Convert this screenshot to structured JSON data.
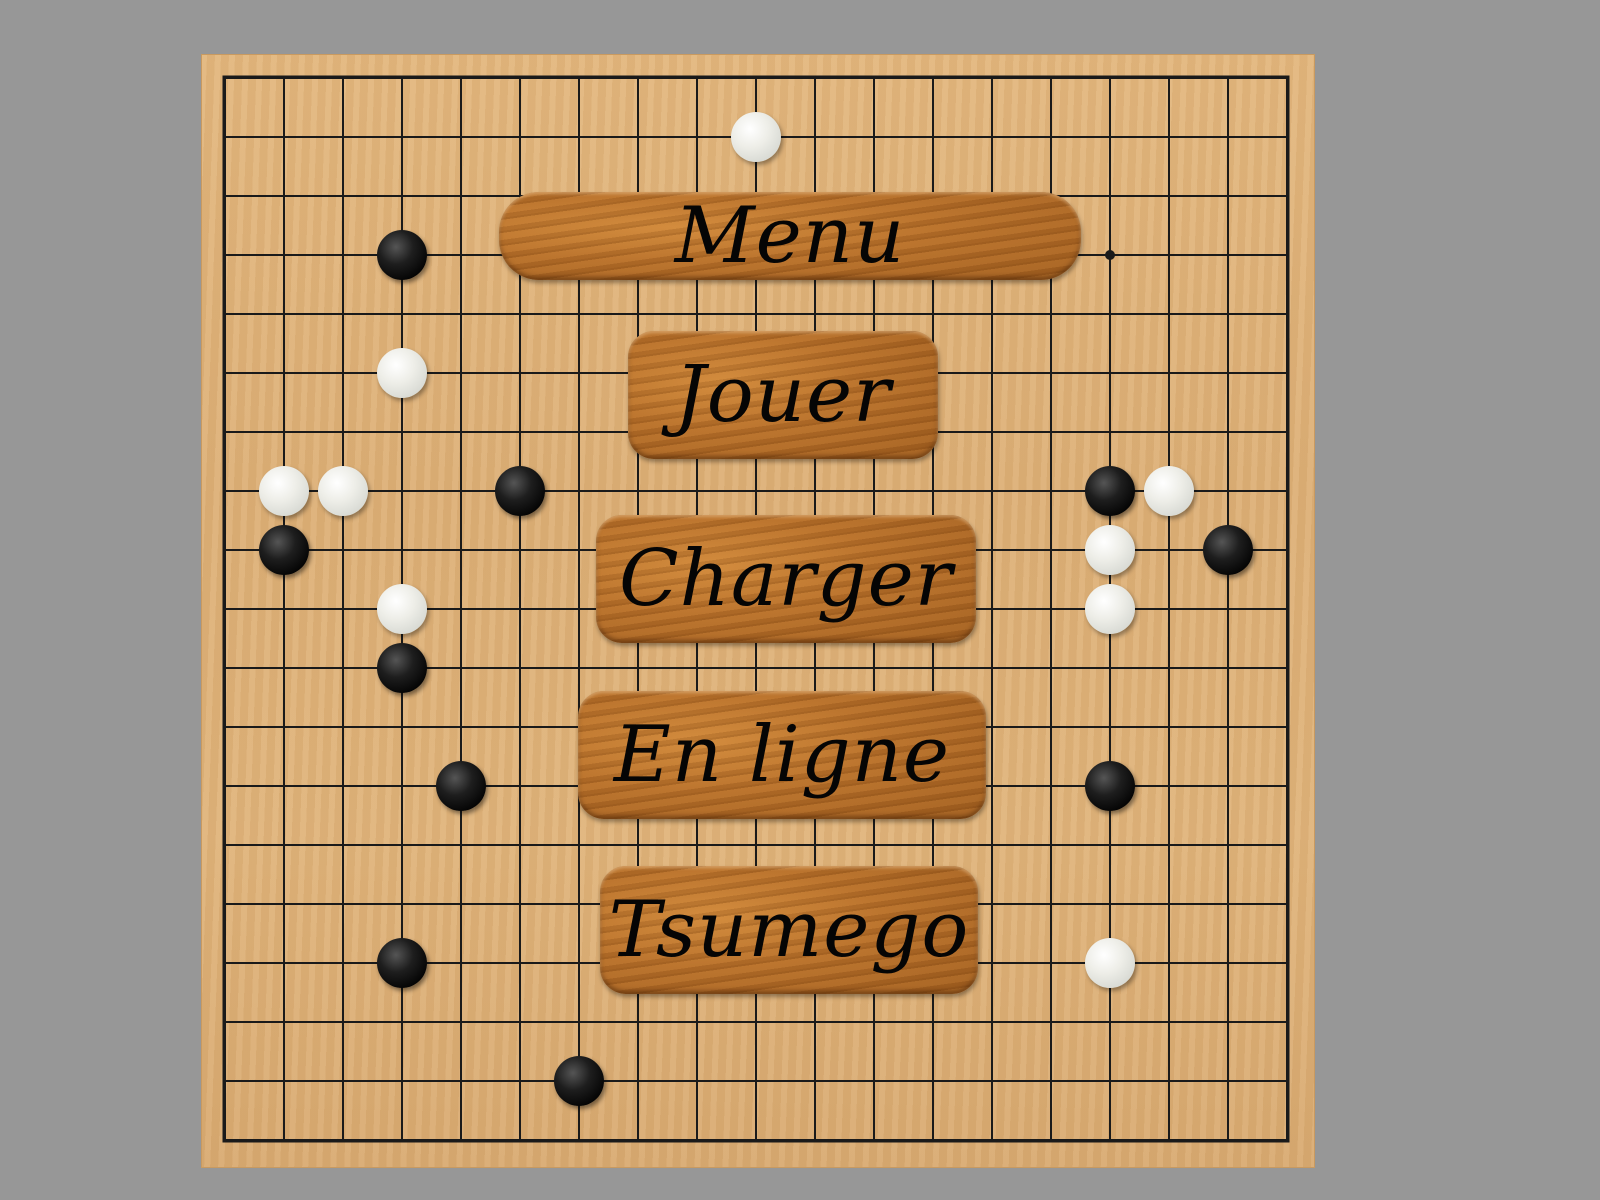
{
  "menu": {
    "title": "Menu",
    "items": [
      {
        "label": "Jouer"
      },
      {
        "label": "Charger"
      },
      {
        "label": "En ligne"
      },
      {
        "label": "Tsumego"
      }
    ]
  },
  "board": {
    "size": 19,
    "colors": {
      "black": "#0a0a0a",
      "white": "#e8e9e4",
      "wood": "#dfb37a",
      "plank": "#b8702a",
      "line": "#1a1a1a"
    },
    "star_points": [
      {
        "col": 15,
        "row": 3
      }
    ],
    "stones": [
      {
        "color": "white",
        "col": 9,
        "row": 1
      },
      {
        "color": "black",
        "col": 3,
        "row": 3
      },
      {
        "color": "white",
        "col": 3,
        "row": 5
      },
      {
        "color": "white",
        "col": 1,
        "row": 7
      },
      {
        "color": "white",
        "col": 2,
        "row": 7
      },
      {
        "color": "black",
        "col": 5,
        "row": 7
      },
      {
        "color": "black",
        "col": 15,
        "row": 7
      },
      {
        "color": "white",
        "col": 16,
        "row": 7
      },
      {
        "color": "black",
        "col": 1,
        "row": 8
      },
      {
        "color": "white",
        "col": 15,
        "row": 8
      },
      {
        "color": "black",
        "col": 17,
        "row": 8
      },
      {
        "color": "white",
        "col": 3,
        "row": 9
      },
      {
        "color": "white",
        "col": 15,
        "row": 9
      },
      {
        "color": "black",
        "col": 3,
        "row": 10
      },
      {
        "color": "black",
        "col": 4,
        "row": 12
      },
      {
        "color": "black",
        "col": 15,
        "row": 12
      },
      {
        "color": "black",
        "col": 3,
        "row": 15
      },
      {
        "color": "white",
        "col": 15,
        "row": 15
      },
      {
        "color": "black",
        "col": 6,
        "row": 17
      }
    ]
  }
}
